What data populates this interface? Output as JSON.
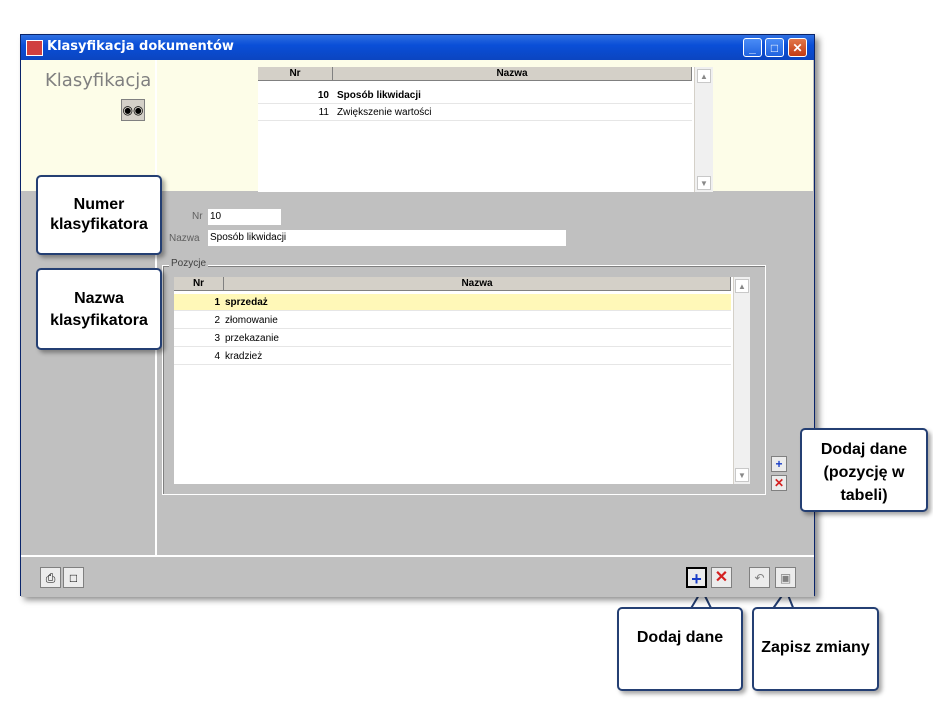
{
  "window": {
    "title": "Klasyfikacja dokumentów",
    "minimize_icon": "minimize-icon",
    "maximize_icon": "maximize-icon",
    "close_icon": "close-icon"
  },
  "left_panel": {
    "title": "Klasyfikacja",
    "search_icon": "binoculars-icon"
  },
  "top_grid": {
    "columns": [
      "Nr",
      "Nazwa"
    ],
    "rows": [
      {
        "nr": "10",
        "name": "Sposób likwidacji",
        "bold": true
      },
      {
        "nr": "11",
        "name": "Zwiększenie wartości",
        "bold": false
      }
    ]
  },
  "form": {
    "nr_label": "Nr",
    "nr_value": "10",
    "name_label": "Nazwa",
    "name_value": "Sposób likwidacji"
  },
  "positions": {
    "group_label": "Pozycje",
    "columns": [
      "Nr",
      "Nazwa"
    ],
    "rows": [
      {
        "nr": "1",
        "name": "sprzedaż",
        "selected": true
      },
      {
        "nr": "2",
        "name": "złomowanie",
        "selected": false
      },
      {
        "nr": "3",
        "name": "przekazanie",
        "selected": false
      },
      {
        "nr": "4",
        "name": "kradzież",
        "selected": false
      }
    ],
    "add_icon": "plus-icon",
    "delete_icon": "x-icon"
  },
  "toolbar": {
    "print_icon": "printer-icon",
    "screen_icon": "monitor-icon",
    "add_icon": "plus-icon",
    "delete_icon": "x-icon",
    "undo_icon": "undo-icon",
    "save_icon": "floppy-icon"
  },
  "callouts": {
    "numer": "Numer klasyfikatora",
    "nazwa": "Nazwa klasyfikatora",
    "dodaj_pozycje": "Dodaj dane (pozycję w tabeli)",
    "dodaj": "Dodaj dane",
    "zapisz": "Zapisz zmiany"
  },
  "colors": {
    "titlebar": "#0a4fd8",
    "selected_row": "#fff8b8",
    "callout_border": "#243f73",
    "add_blue": "#1a3ec8",
    "delete_red": "#d42020"
  }
}
